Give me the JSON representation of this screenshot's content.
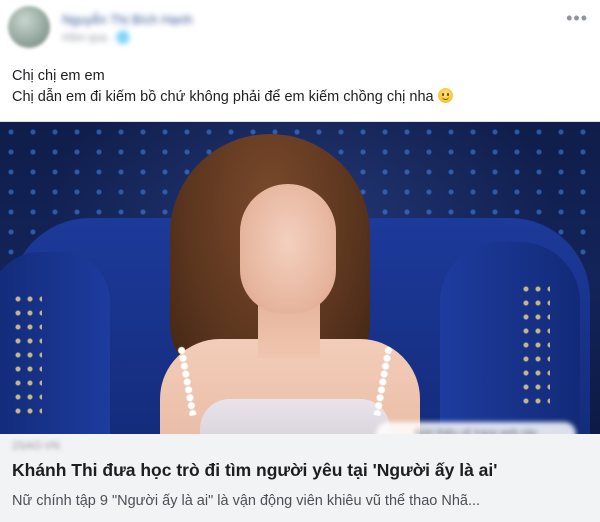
{
  "post": {
    "author_name": "Nguyễn Thị Bích Hạnh",
    "meta": "Hôm qua · 🌐",
    "more_icon": "more-horizontal-icon",
    "text_lines": [
      "Chị chị em em",
      "Chị dẫn em đi kiếm bồ chứ không phải để em kiếm chồng chị nha"
    ],
    "emoji": "smile-emoji-icon"
  },
  "link_card": {
    "image_overlay_text": "Giới thiệu về trang web này",
    "domain": "2SAO.VN",
    "title": "Khánh Thi đưa học trò đi tìm người yêu tại 'Người ấy là ai'",
    "description": "Nữ chính tập 9 \"Người ấy là ai\" là vận động viên khiêu vũ thể thao Nhã..."
  },
  "colors": {
    "link_blue": "#385898",
    "meta_gray": "#90949c",
    "text_dark": "#1c1e21",
    "card_bg": "#f2f3f5"
  }
}
